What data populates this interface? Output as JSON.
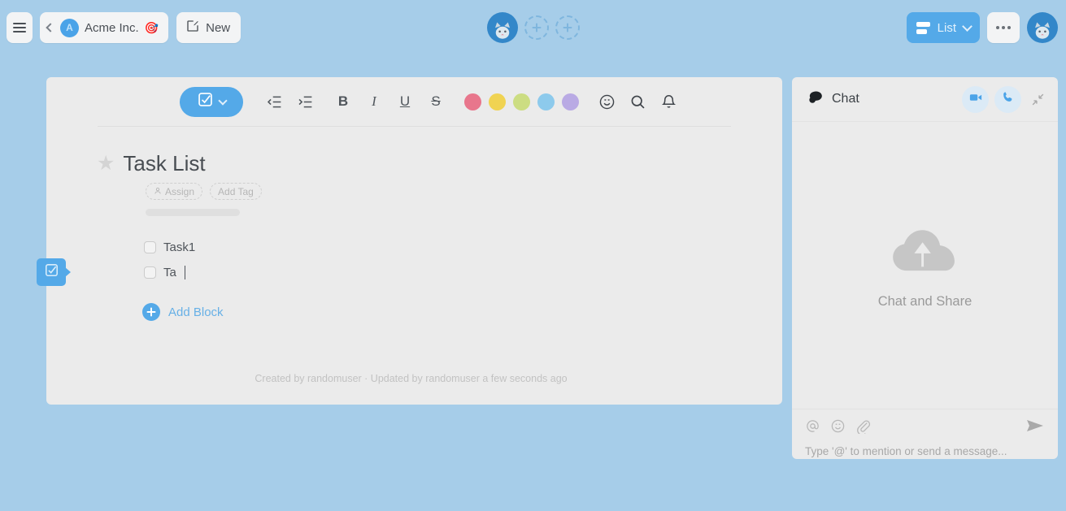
{
  "colors": {
    "app_background": "#a6cde9",
    "card_background": "#ebebeb",
    "accent_blue": "#54a9e8",
    "avatar_blue": "#3387c9",
    "text_dark": "#4a4f55",
    "text_muted": "#a8a8a8"
  },
  "topbar": {
    "menu_icon": "hamburger-icon",
    "back_icon": "chevron-left-icon",
    "workspace": {
      "avatar_initial": "A",
      "name": "Acme Inc.",
      "emoji": "🎯"
    },
    "new_button": {
      "label": "New",
      "icon": "compose-icon"
    },
    "center": {
      "avatar_icon": "cat-avatar-icon",
      "add_slots": [
        "plus-icon",
        "plus-icon"
      ]
    },
    "view_switcher": {
      "label": "List",
      "icon": "list-view-icon",
      "chevron": "chevron-down-icon"
    },
    "more_button": {
      "icon": "ellipsis-icon",
      "label": "•••"
    },
    "user_avatar_icon": "cat-avatar-icon"
  },
  "editor_toolbar": {
    "block_type": {
      "icon": "checkbox-checked-icon",
      "chevron": "chevron-down-icon"
    },
    "buttons": [
      {
        "name": "outdent-icon",
        "label": ""
      },
      {
        "name": "indent-icon",
        "label": ""
      },
      {
        "name": "bold-button",
        "label": "B"
      },
      {
        "name": "italic-button",
        "label": "I"
      },
      {
        "name": "underline-button",
        "label": "U"
      },
      {
        "name": "strikethrough-button",
        "label": "S"
      }
    ],
    "colors": [
      {
        "name": "color-swatch-red",
        "hex": "#e8768c"
      },
      {
        "name": "color-swatch-yellow",
        "hex": "#f0d352"
      },
      {
        "name": "color-swatch-lime",
        "hex": "#ccdd82"
      },
      {
        "name": "color-swatch-blue",
        "hex": "#8dcaec"
      },
      {
        "name": "color-swatch-purple",
        "hex": "#b9aae4"
      }
    ],
    "trailing": [
      {
        "name": "emoji-icon"
      },
      {
        "name": "search-icon"
      },
      {
        "name": "bell-icon"
      }
    ]
  },
  "document": {
    "star_icon": "star-icon",
    "title": "Task List",
    "assign_pill": {
      "label": "Assign",
      "icon": "person-icon"
    },
    "tag_pill": {
      "label": "Add Tag"
    },
    "tasks": [
      {
        "label": "Task1",
        "checked": false,
        "editing": false
      },
      {
        "label": "Ta",
        "checked": false,
        "editing": true
      }
    ],
    "add_block": {
      "label": "Add Block",
      "icon": "plus-circle-icon"
    },
    "footer": "Created by randomuser · Updated by randomuser a few seconds ago"
  },
  "left_tab": {
    "icon": "checkbox-checked-icon"
  },
  "chat": {
    "title": "Chat",
    "title_icon": "chat-bubble-icon",
    "video_call_icon": "video-camera-icon",
    "voice_call_icon": "phone-icon",
    "collapse_icon": "collapse-arrows-icon",
    "empty_state": {
      "icon": "cloud-upload-icon",
      "label": "Chat and Share"
    },
    "composer": {
      "mention_icon": "at-sign-icon",
      "emoji_icon": "emoji-icon",
      "attach_icon": "paperclip-icon",
      "send_icon": "send-icon",
      "placeholder": "Type '@' to mention or send a message..."
    }
  }
}
